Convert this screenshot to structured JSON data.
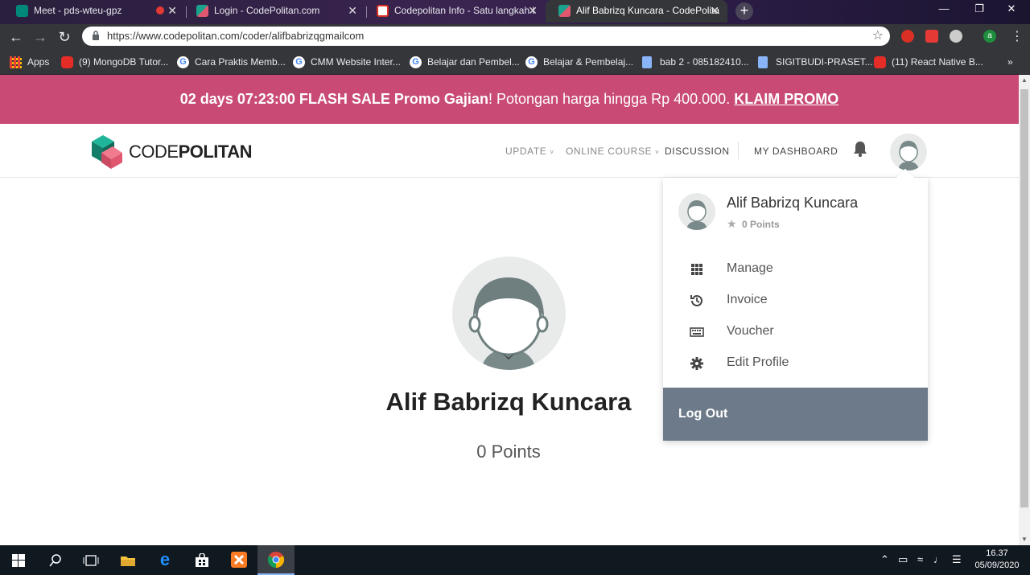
{
  "browser": {
    "tabs": [
      {
        "title": "Meet - pds-wteu-gpz",
        "favicon": "meet-icon"
      },
      {
        "title": "Login - CodePolitan.com",
        "favicon": "codepolitan-icon"
      },
      {
        "title": "Codepolitan Info - Satu langkah l",
        "favicon": "gmail-icon"
      },
      {
        "title": "Alif Babrizq Kuncara - CodePolita",
        "favicon": "codepolitan-icon"
      }
    ],
    "url": "https://www.codepolitan.com/coder/alifbabrizqgmailcom",
    "profile_initial": "a",
    "bookmarks": [
      {
        "label": "Apps",
        "icon": "apps-grid-icon"
      },
      {
        "label": "(9) MongoDB Tutor...",
        "icon": "youtube-icon"
      },
      {
        "label": "Cara Praktis Memb...",
        "icon": "google-icon"
      },
      {
        "label": "CMM Website Inter...",
        "icon": "google-icon"
      },
      {
        "label": "Belajar dan Pembel...",
        "icon": "google-icon"
      },
      {
        "label": "Belajar & Pembelaj...",
        "icon": "google-icon"
      },
      {
        "label": "bab 2 - 085182410...",
        "icon": "doc-icon"
      },
      {
        "label": "SIGITBUDI-PRASET...",
        "icon": "doc-icon"
      },
      {
        "label": "(11) React Native B...",
        "icon": "youtube-icon"
      }
    ],
    "bookmarks_overflow": "»"
  },
  "promo": {
    "countdown": "02 days 07:23:00",
    "headline": "FLASH SALE Promo Gajian",
    "exclaim": "!",
    "text": " Potongan harga hingga Rp 400.000. ",
    "cta": "KLAIM PROMO",
    "bg_color": "#c94a74"
  },
  "site": {
    "logo_light": "CODE",
    "logo_bold": "POLITAN",
    "nav": [
      {
        "label": "UPDATE",
        "dropdown": true
      },
      {
        "label": "ONLINE COURSE",
        "dropdown": true
      },
      {
        "label": "DISCUSSION",
        "dropdown": false
      },
      {
        "label": "MY DASHBOARD",
        "dropdown": false
      }
    ]
  },
  "profile": {
    "name": "Alif Babrizq Kuncara",
    "points": "0 Points"
  },
  "user_menu": {
    "name": "Alif Babrizq Kuncara",
    "points": "0 Points",
    "items": [
      {
        "label": "Manage",
        "icon": "grid-icon"
      },
      {
        "label": "Invoice",
        "icon": "history-icon"
      },
      {
        "label": "Voucher",
        "icon": "keyboard-icon"
      },
      {
        "label": "Edit Profile",
        "icon": "gear-icon"
      }
    ],
    "logout": "Log Out",
    "logout_color": "#6c7a89"
  },
  "taskbar": {
    "time": "16.37",
    "date": "05/09/2020"
  }
}
